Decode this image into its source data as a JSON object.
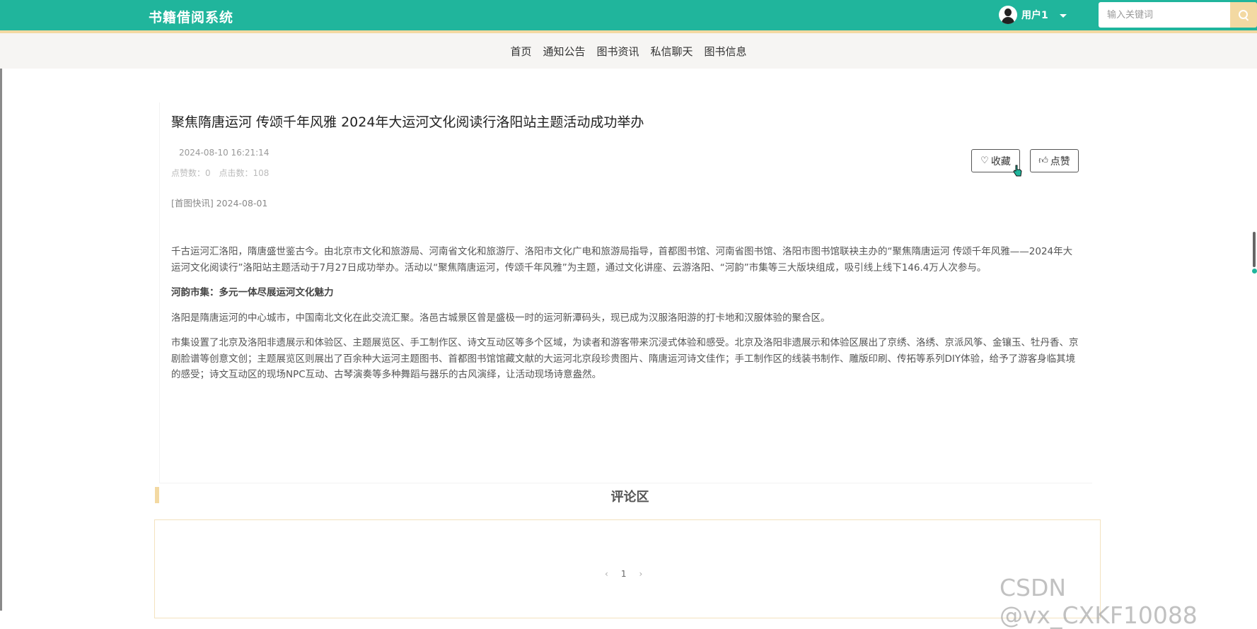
{
  "header": {
    "app_title": "书籍借阅系统",
    "user_label": "用户1",
    "search_placeholder": "输入关键词"
  },
  "nav": {
    "items": [
      "首页",
      "通知公告",
      "图书资讯",
      "私信聊天",
      "图书信息"
    ]
  },
  "article": {
    "title": "聚焦隋唐运河 传颂千年风雅 2024年大运河文化阅读行洛阳站主题活动成功举办",
    "datetime": "2024-08-10 16:21:14",
    "likes_label": "点赞数：0",
    "clicks_label": "点击数：108",
    "source": "[首图快讯] 2024-08-01",
    "favorite_label": "收藏",
    "like_label": "点赞",
    "paragraphs": [
      "千古运河汇洛阳，隋唐盛世鉴古今。由北京市文化和旅游局、河南省文化和旅游厅、洛阳市文化广电和旅游局指导，首都图书馆、河南省图书馆、洛阳市图书馆联袂主办的“聚焦隋唐运河 传颂千年风雅——2024年大运河文化阅读行”洛阳站主题活动于7月27日成功举办。活动以“聚焦隋唐运河，传颂千年风雅”为主题，通过文化讲座、云游洛阳、“河韵”市集等三大版块组成，吸引线上线下146.4万人次参与。",
      "河韵市集：多元一体尽展运河文化魅力",
      "洛阳是隋唐运河的中心城市，中国南北文化在此交流汇聚。洛邑古城景区曾是盛极一时的运河新潭码头，现已成为汉服洛阳游的打卡地和汉服体验的聚合区。",
      "市集设置了北京及洛阳非遗展示和体验区、主题展览区、手工制作区、诗文互动区等多个区域，为读者和游客带来沉浸式体验和感受。北京及洛阳非遗展示和体验区展出了京绣、洛绣、京派风筝、金镶玉、牡丹香、京剧脸谱等创意文创；主题展览区则展出了百余种大运河主题图书、首都图书馆馆藏文献的大运河北京段珍贵图片、隋唐运河诗文佳作；手工制作区的线装书制作、雕版印刷、传拓等系列DIY体验，给予了游客身临其境的感受；诗文互动区的现场NPC互动、古琴演奏等多种舞蹈与器乐的古风演绎，让活动现场诗意盎然。"
    ]
  },
  "comments": {
    "title": "评论区",
    "pager": {
      "prev": "‹",
      "page": "1",
      "next": "›"
    }
  },
  "watermark": "CSDN @vx_CXKF10088"
}
